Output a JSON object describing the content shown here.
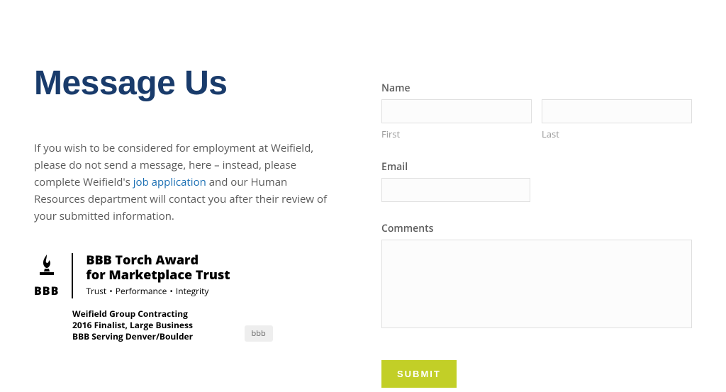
{
  "heading": "Message Us",
  "intro_before": "If you wish to be considered for employment at Weifield, please do not send a message, here – instead, please complete Weifield's ",
  "intro_link": "job application",
  "intro_after": "  and our Human Resources department will contact you after their review of your submitted information.",
  "badge": {
    "bbb_label": "BBB",
    "award_line1": "BBB Torch Award",
    "award_line2": "for Marketplace Trust",
    "sub_trust": "Trust",
    "sub_perf": "Performance",
    "sub_integ": "Integrity",
    "meta1": "Weifield Group Contracting",
    "meta2": "2016 Finalist, Large Business",
    "meta3": "BBB Serving Denver/Boulder",
    "caption": "bbb"
  },
  "form": {
    "name_label": "Name",
    "first_label": "First",
    "last_label": "Last",
    "email_label": "Email",
    "comments_label": "Comments",
    "submit_label": "SUBMIT"
  }
}
